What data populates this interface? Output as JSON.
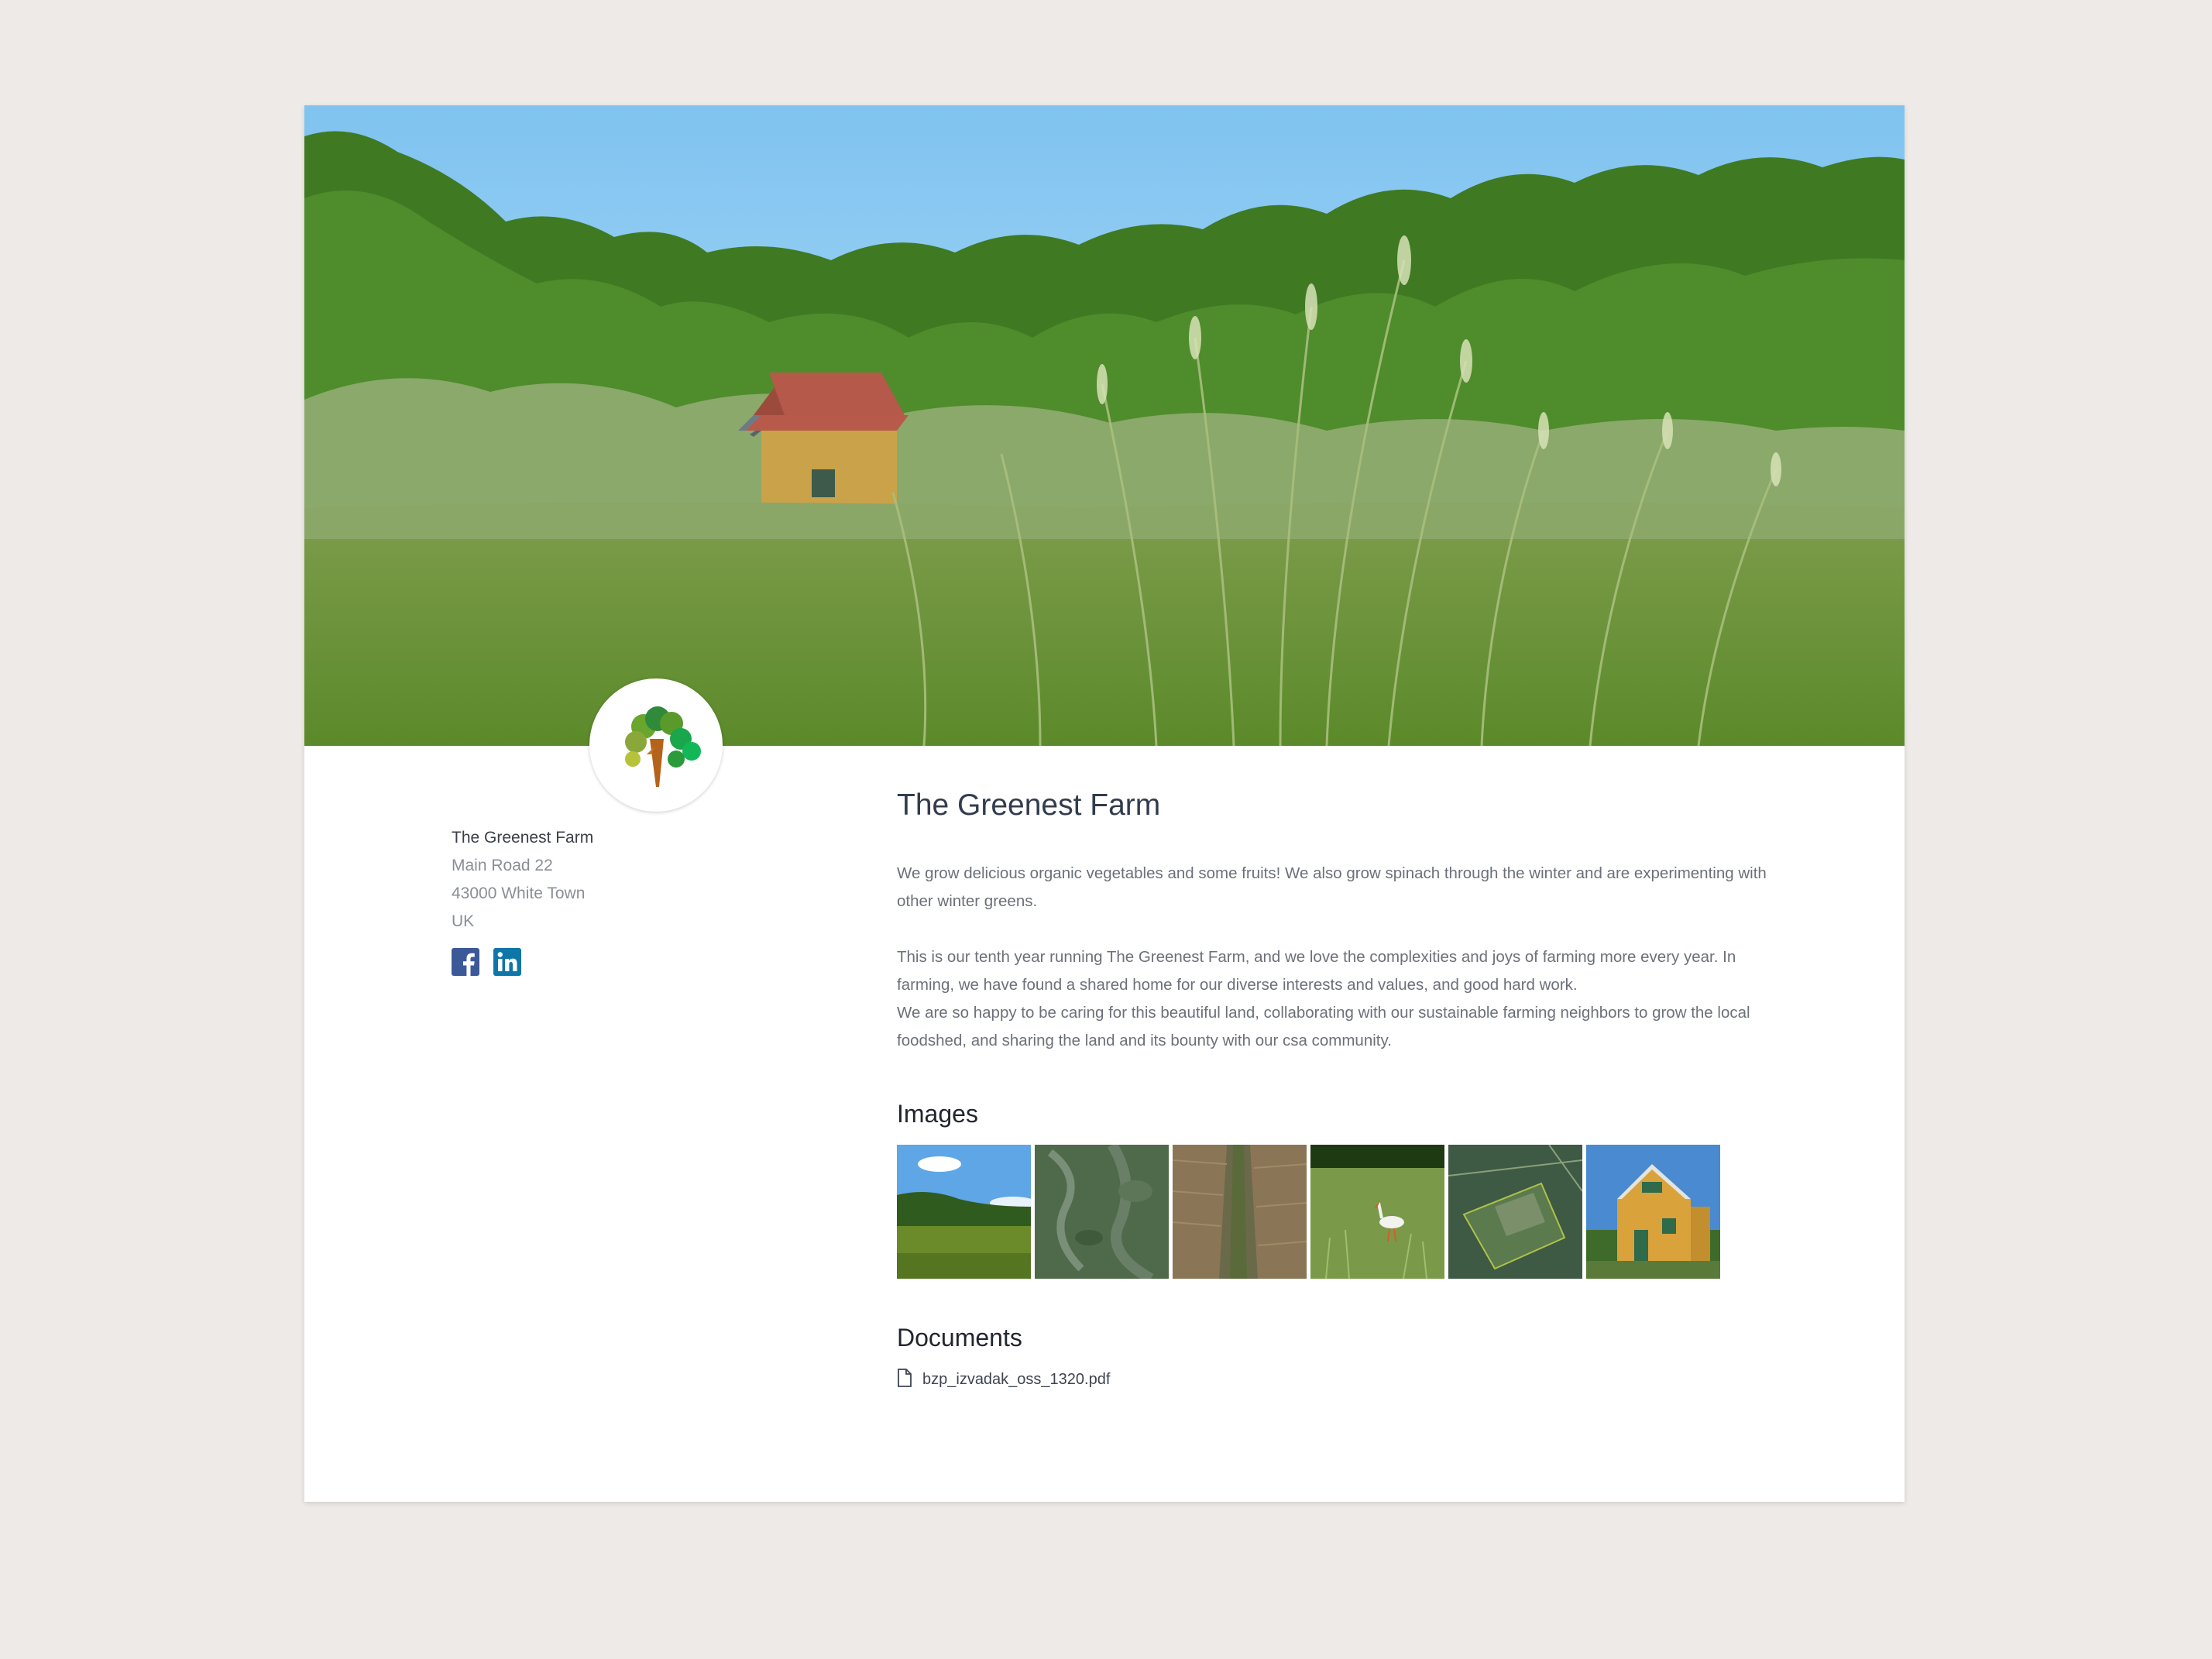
{
  "farm": {
    "name": "The Greenest Farm",
    "address": {
      "street": "Main Road 22",
      "city_line": "43000 White Town",
      "country": "UK"
    },
    "social": [
      {
        "icon": "facebook-icon",
        "color": "#3b5998"
      },
      {
        "icon": "linkedin-icon",
        "color": "#0e76a8"
      }
    ]
  },
  "main": {
    "title": "The Greenest Farm",
    "paragraphs": [
      "We grow delicious organic vegetables and some fruits! We also grow spinach through the winter and are experimenting with other winter greens.",
      "This is our tenth year running The Greenest Farm, and we love the complexities and joys of farming more every year. In farming, we have found a shared home for our diverse interests and values, and good hard work.",
      "We are so happy to be caring for this beautiful land, collaborating with our sustainable farming neighbors to grow the local foodshed, and sharing the land and its bounty with our csa community."
    ],
    "images_heading": "Images",
    "images": [
      {
        "subject": "meadow-with-forest"
      },
      {
        "subject": "aerial-map"
      },
      {
        "subject": "dirt-path-field"
      },
      {
        "subject": "stork-in-grass"
      },
      {
        "subject": "aerial-fields"
      },
      {
        "subject": "yellow-cabin"
      }
    ],
    "documents_heading": "Documents",
    "documents": [
      {
        "name": "bzp_izvadak_oss_1320.pdf",
        "icon": "file-icon"
      }
    ]
  },
  "colors": {
    "page_background": "#edeae7",
    "title": "#323c4e",
    "body_text": "#6c7079"
  }
}
